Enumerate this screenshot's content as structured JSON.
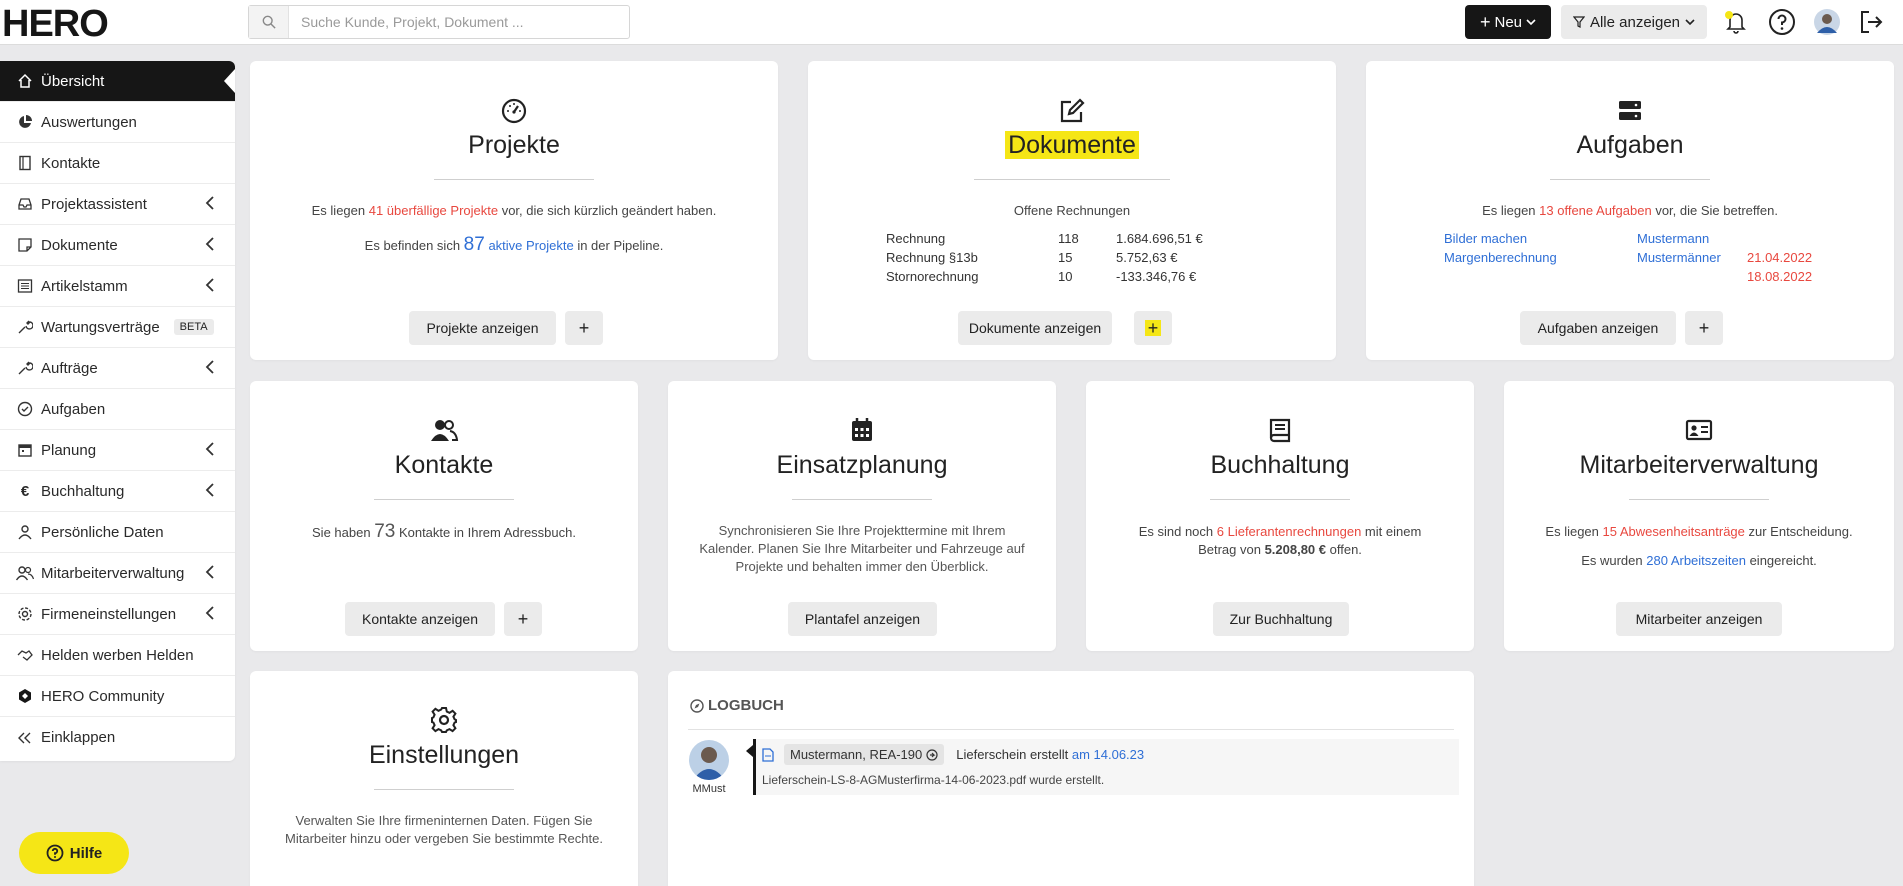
{
  "brand": {
    "logo_text": "HERO",
    "accent": "#f5e616",
    "dark": "#161616"
  },
  "header": {
    "search_placeholder": "Suche Kunde, Projekt, Dokument ...",
    "new_label": "Neu",
    "filter_label": "Alle anzeigen"
  },
  "sidebar": {
    "items": [
      {
        "label": "Übersicht",
        "icon": "home-icon"
      },
      {
        "label": "Auswertungen",
        "icon": "pie-chart-icon"
      },
      {
        "label": "Kontakte",
        "icon": "address-book-icon"
      },
      {
        "label": "Projektassistent",
        "icon": "inbox-icon"
      },
      {
        "label": "Dokumente",
        "icon": "note-icon"
      },
      {
        "label": "Artikelstamm",
        "icon": "list-icon"
      },
      {
        "label": "Wartungsverträge",
        "icon": "wrench-icon",
        "badge": "BETA"
      },
      {
        "label": "Aufträge",
        "icon": "wrench-icon"
      },
      {
        "label": "Aufgaben",
        "icon": "check-circle-icon"
      },
      {
        "label": "Planung",
        "icon": "calendar-icon"
      },
      {
        "label": "Buchhaltung",
        "icon": "euro-icon"
      },
      {
        "label": "Persönliche Daten",
        "icon": "user-icon"
      },
      {
        "label": "Mitarbeiterverwaltung",
        "icon": "users-icon"
      },
      {
        "label": "Firmeneinstellungen",
        "icon": "gear-icon"
      },
      {
        "label": "Helden werben Helden",
        "icon": "handshake-icon"
      },
      {
        "label": "HERO Community",
        "icon": "hero-logo-icon"
      },
      {
        "label": "Einklappen",
        "icon": "double-chevron-left-icon"
      }
    ]
  },
  "projekte": {
    "title": "Projekte",
    "line1_pre": "Es liegen ",
    "line1_highlight": "41 überfällige Projekte",
    "line1_post": " vor, die sich kürzlich geändert haben.",
    "line2_pre": "Es befinden sich ",
    "line2_number": "87",
    "line2_link": "aktive Projekte",
    "line2_post": " in der Pipeline.",
    "button": "Projekte anzeigen",
    "plus": "+"
  },
  "dokumente": {
    "title": "Dokumente",
    "subtitle": "Offene Rechnungen",
    "rows": [
      {
        "type": "Rechnung",
        "count": "118",
        "amount": "1.684.696,51 €"
      },
      {
        "type": "Rechnung §13b",
        "count": "15",
        "amount": "5.752,63 €"
      },
      {
        "type": "Stornorechnung",
        "count": "10",
        "amount": "-133.346,76 €"
      }
    ],
    "button": "Dokumente anzeigen",
    "plus": "+"
  },
  "aufgaben": {
    "title": "Aufgaben",
    "line_pre": "Es liegen ",
    "line_highlight": "13 offene Aufgaben",
    "line_post": " vor, die Sie betreffen.",
    "tasks": [
      {
        "name": "Bilder machen",
        "assignee": "Mustermann",
        "date": ""
      },
      {
        "name": "Margenberechnung",
        "assignee": "Mustermänner",
        "date": "21.04.2022"
      },
      {
        "name": "",
        "assignee": "",
        "date": "18.08.2022"
      }
    ],
    "button": "Aufgaben anzeigen",
    "plus": "+"
  },
  "kontakte": {
    "title": "Kontakte",
    "line_pre": "Sie haben ",
    "line_number": "73",
    "line_post": " Kontakte in Ihrem Adressbuch.",
    "button": "Kontakte anzeigen",
    "plus": "+"
  },
  "einsatzplanung": {
    "title": "Einsatzplanung",
    "line1": "Synchronisieren Sie Ihre Projekttermine mit Ihrem",
    "line2": "Kalender. Planen Sie Ihre Mitarbeiter und Fahrzeuge auf",
    "line3": "Projekte und behalten immer den Überblick.",
    "button": "Plantafel anzeigen"
  },
  "buchhaltung": {
    "title": "Buchhaltung",
    "line1_pre": "Es sind noch ",
    "line1_highlight": "6 Lieferantenrechnungen",
    "line1_post": " mit einem",
    "line2_pre": "Betrag von ",
    "line2_amount": "5.208,80 €",
    "line2_post": " offen.",
    "button": "Zur Buchhaltung"
  },
  "mitarbeiter": {
    "title": "Mitarbeiterverwaltung",
    "line1_pre": "Es liegen ",
    "line1_highlight": "15 Abwesenheitsanträge",
    "line1_post": " zur Entscheidung.",
    "line2_pre": "Es wurden ",
    "line2_link": "280 Arbeitszeiten",
    "line2_post": " eingereicht.",
    "button": "Mitarbeiter anzeigen"
  },
  "einstellungen": {
    "title": "Einstellungen",
    "line1": "Verwalten Sie Ihre firmeninternen Daten. Fügen Sie",
    "line2": "Mitarbeiter hinzu oder vergeben Sie bestimmte Rechte."
  },
  "logbuch": {
    "title": "LOGBUCH",
    "entries": [
      {
        "user": "MMust",
        "chip": "Mustermann, REA-190",
        "action": "Lieferschein erstellt",
        "date_link": "am 14.06.23",
        "detail": "Lieferschein-LS-8-AGMusterfirma-14-06-2023.pdf wurde erstellt."
      }
    ]
  },
  "help": {
    "label": "Hilfe"
  }
}
